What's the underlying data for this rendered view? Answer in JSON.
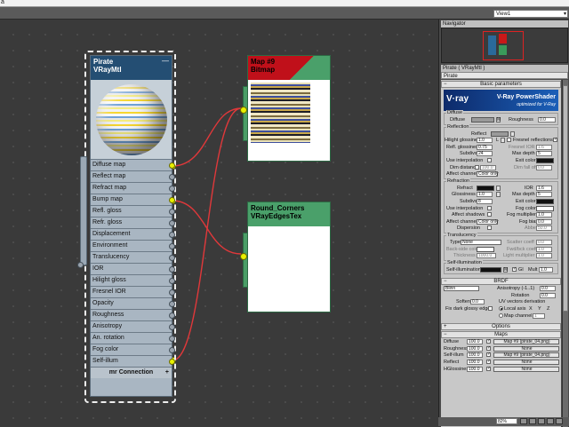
{
  "window": {
    "menu_glyph": "ä",
    "view_selector": "View1",
    "view_arrow": "▾"
  },
  "material_node": {
    "name": "Pirate",
    "type": "VRayMtl",
    "minimize": "—",
    "slots": [
      {
        "label": "Diffuse map",
        "connected": true
      },
      {
        "label": "Reflect map",
        "connected": false
      },
      {
        "label": "Refract map",
        "connected": false
      },
      {
        "label": "Bump map",
        "connected": true
      },
      {
        "label": "Refl. gloss",
        "connected": false
      },
      {
        "label": "Refr. gloss",
        "connected": false
      },
      {
        "label": "Displacement",
        "connected": false
      },
      {
        "label": "Environment",
        "connected": false
      },
      {
        "label": "Translucency",
        "connected": false
      },
      {
        "label": "IOR",
        "connected": false
      },
      {
        "label": "Hilight gloss",
        "connected": false
      },
      {
        "label": "Fresnel IOR",
        "connected": false
      },
      {
        "label": "Opacity",
        "connected": false
      },
      {
        "label": "Roughness",
        "connected": false
      },
      {
        "label": "Anisotropy",
        "connected": false
      },
      {
        "label": "An. rotation",
        "connected": false
      },
      {
        "label": "Fog color",
        "connected": false
      },
      {
        "label": "Self-illum",
        "connected": true
      }
    ],
    "connection_label": "mr Connection",
    "connection_plus": "+"
  },
  "bitmap_node": {
    "name": "Map #9",
    "type": "Bitmap"
  },
  "edges_node": {
    "name": "Round_Corners",
    "type": "VRayEdgesTex"
  },
  "navigator": {
    "title": "Navigator"
  },
  "param_panel": {
    "title": "Pirate  ( VRayMtl )",
    "material_name": "Pirate",
    "basic_rollout": "Basic parameters",
    "banner": {
      "logo": "V·ray",
      "product": "V-Ray PowerShader",
      "subtitle": "optimized for V-Ray"
    },
    "diffuse": {
      "group": "Diffuse",
      "diffuse_label": "Diffuse",
      "m": "M",
      "roughness_label": "Roughness",
      "roughness": "0.0"
    },
    "reflection": {
      "group": "Reflection",
      "reflect": "Reflect",
      "hilight_gloss": "Hilight glossiness",
      "hilight_gloss_val": "1.0",
      "l": "L",
      "fresnel": "Fresnel reflections",
      "refl_gloss": "Refl. glossiness",
      "refl_gloss_val": "0.75",
      "fresnel_ior": "Fresnel IOR",
      "fresnel_ior_val": "1.6",
      "subdivs": "Subdivs",
      "subdivs_val": "24",
      "max_depth": "Max depth",
      "max_depth_val": "5",
      "use_interp": "Use interpolation",
      "exit_color": "Exit color",
      "dim_distance": "Dim distance",
      "dim_distance_val": "100.0",
      "dim_falloff": "Dim fall off",
      "dim_falloff_val": "0.0",
      "affect_channels": "Affect channels",
      "affect_channels_val": "Color only"
    },
    "refraction": {
      "group": "Refraction",
      "refract": "Refract",
      "ior": "IOR",
      "ior_val": "1.6",
      "glossiness": "Glossiness",
      "glossiness_val": "1.0",
      "max_depth": "Max depth",
      "max_depth_val": "5",
      "subdivs": "Subdivs",
      "subdivs_val": "8",
      "exit_color": "Exit color",
      "use_interp": "Use interpolation",
      "fog_color": "Fog color",
      "affect_shadows": "Affect shadows",
      "fog_mult": "Fog multiplier",
      "fog_mult_val": "1.0",
      "affect_channels": "Affect channels",
      "affect_channels_val": "Color only",
      "fog_bias": "Fog bias",
      "fog_bias_val": "0.0",
      "dispersion": "Dispersion",
      "abbe": "Abbe",
      "abbe_val": "50.0"
    },
    "translucency": {
      "group": "Translucency",
      "type": "Type",
      "type_val": "None",
      "scatter": "Scatter coeff",
      "scatter_val": "0.0",
      "back_side": "Back-side color",
      "fwd_bck": "Fwd/bck coeff",
      "fwd_bck_val": "1.0",
      "thickness": "Thickness",
      "thickness_val": "1000.0",
      "light_mult": "Light multiplier",
      "light_mult_val": "1.0"
    },
    "self_illum": {
      "group": "Self-illumination",
      "label": "Self-illumination",
      "m": "M",
      "gi": "GI",
      "mult": "Mult",
      "mult_val": "1.0"
    },
    "brdf": {
      "rollout": "BRDF",
      "type": "Blinn",
      "anisotropy": "Anisotropy (-1..1)",
      "anisotropy_val": "0.0",
      "rotation": "Rotation",
      "rotation_val": "0.0",
      "soften": "Soften",
      "soften_val": "0.0",
      "uv_deriv": "UV vectors derivation",
      "fix_dark": "Fix dark glossy edges",
      "local_axis": "Local axis",
      "x": "X",
      "y": "Y",
      "z": "Z",
      "map_channel": "Map channel",
      "map_channel_val": "1"
    },
    "options_rollout": "Options",
    "maps_rollout": "Maps",
    "maps": [
      {
        "label": "Diffuse",
        "amount": "100.0",
        "map": "Map #9 (pirate_04.png)"
      },
      {
        "label": "Roughness",
        "amount": "100.0",
        "map": "None"
      },
      {
        "label": "Self-illum",
        "amount": "100.0",
        "map": "Map #9 (pirate_04.png)"
      },
      {
        "label": "Reflect",
        "amount": "100.0",
        "map": "None"
      },
      {
        "label": "HGlossiness",
        "amount": "100.0",
        "map": "None"
      }
    ]
  },
  "status": {
    "zoom": "82%"
  },
  "colors": {
    "mtl_header": "#244e73",
    "bitmap_header": "#c0101a",
    "map_node_green": "#4aa06a",
    "wire": "#e0383a",
    "socket_active": "#e8f000"
  }
}
